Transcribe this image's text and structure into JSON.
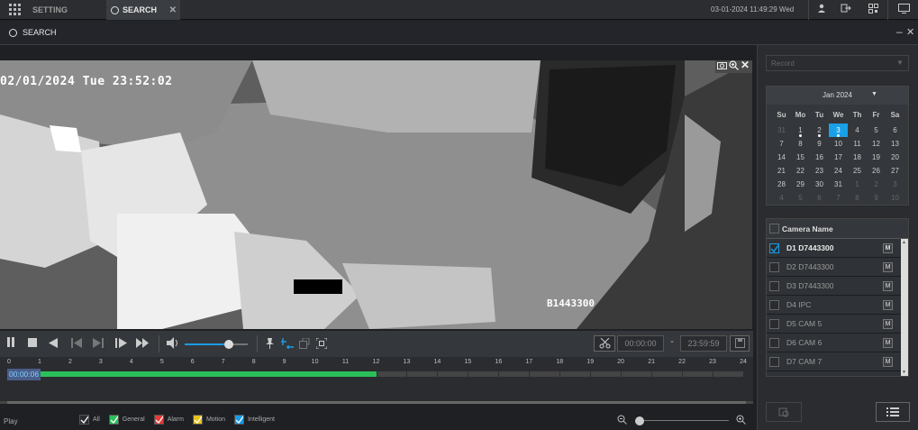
{
  "topbar": {
    "tabs": [
      {
        "label": "SETTING"
      },
      {
        "label": "SEARCH"
      }
    ],
    "datetime": "03-01-2024 11:49:29 Wed"
  },
  "window": {
    "title": "SEARCH"
  },
  "video": {
    "timestamp": "02/01/2024 Tue 23:52:02",
    "watermark": "B1443300"
  },
  "controls": {
    "start_time": "00:00:00",
    "end_time": "23:59:59",
    "time_separator": "-",
    "volume": 0.7
  },
  "timeline": {
    "hours": [
      "0",
      "1",
      "2",
      "3",
      "4",
      "5",
      "6",
      "7",
      "8",
      "9",
      "10",
      "11",
      "12",
      "13",
      "14",
      "15",
      "16",
      "17",
      "18",
      "19",
      "20",
      "21",
      "22",
      "23",
      "24"
    ],
    "current_time": "00:00:06",
    "recorded_until_hour": 12
  },
  "bottom": {
    "play_label": "Play",
    "legend": [
      {
        "label": "All",
        "color": "#2a2c30",
        "checked": true
      },
      {
        "label": "General",
        "color": "#2bbf5a",
        "checked": true
      },
      {
        "label": "Alarm",
        "color": "#e53935",
        "checked": true
      },
      {
        "label": "Motion",
        "color": "#e8c21a",
        "checked": true
      },
      {
        "label": "Intelligent",
        "color": "#1a9be8",
        "checked": true
      }
    ],
    "zoom": 0.0
  },
  "sidebar": {
    "record_placeholder": "Record",
    "calendar": {
      "month": "Jan 2024",
      "weekdays": [
        "Su",
        "Mo",
        "Tu",
        "We",
        "Th",
        "Fr",
        "Sa"
      ],
      "weeks": [
        [
          "31",
          "1",
          "2",
          "3",
          "4",
          "5",
          "6"
        ],
        [
          "7",
          "8",
          "9",
          "10",
          "11",
          "12",
          "13"
        ],
        [
          "14",
          "15",
          "16",
          "17",
          "18",
          "19",
          "20"
        ],
        [
          "21",
          "22",
          "23",
          "24",
          "25",
          "26",
          "27"
        ],
        [
          "28",
          "29",
          "30",
          "31",
          "1",
          "2",
          "3"
        ],
        [
          "4",
          "5",
          "6",
          "7",
          "8",
          "9",
          "10"
        ]
      ],
      "selected": "3",
      "dotted": [
        "1",
        "2",
        "3"
      ]
    },
    "camera_header": "Camera Name",
    "cameras": [
      {
        "name": "D1 D7443300",
        "checked": true,
        "m": "M"
      },
      {
        "name": "D2 D7443300",
        "checked": false,
        "m": "M"
      },
      {
        "name": "D3 D7443300",
        "checked": false,
        "m": "M"
      },
      {
        "name": "D4 IPC",
        "checked": false,
        "m": "M"
      },
      {
        "name": "D5 CAM 5",
        "checked": false,
        "m": "M"
      },
      {
        "name": "D6 CAM 6",
        "checked": false,
        "m": "M"
      },
      {
        "name": "D7 CAM 7",
        "checked": false,
        "m": "M"
      }
    ]
  },
  "colors": {
    "accent": "#1aa0e8",
    "record": "#2bbf5a"
  }
}
